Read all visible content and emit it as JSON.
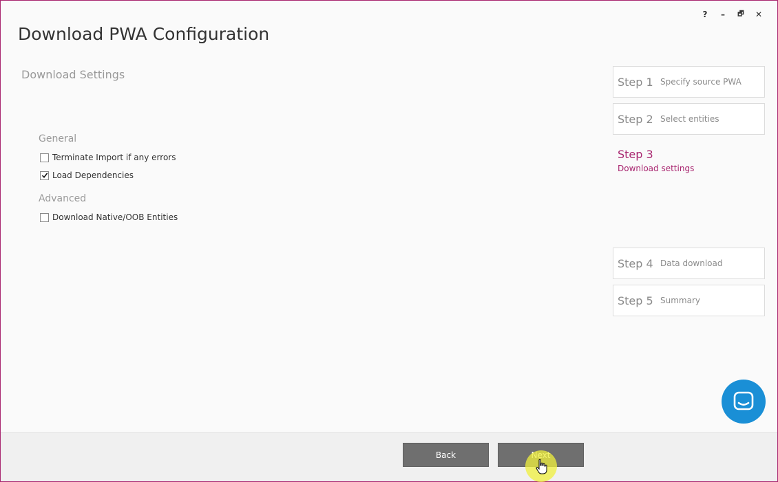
{
  "window": {
    "title": "Download PWA Configuration",
    "controls": {
      "help": "?",
      "minimize": "–",
      "restore": "🗗",
      "close": "✕"
    }
  },
  "section": {
    "title": "Download Settings"
  },
  "general": {
    "label": "General",
    "options": [
      {
        "label": "Terminate Import if any errors",
        "checked": false
      },
      {
        "label": "Load Dependencies",
        "checked": true
      }
    ]
  },
  "advanced": {
    "label": "Advanced",
    "options": [
      {
        "label": "Download Native/OOB Entities",
        "checked": false
      }
    ]
  },
  "steps": [
    {
      "num": "Step 1",
      "desc": "Specify source PWA"
    },
    {
      "num": "Step 2",
      "desc": "Select entities"
    },
    {
      "num": "Step 3",
      "desc": "Download settings",
      "active": true
    },
    {
      "num": "Step 4",
      "desc": "Data download"
    },
    {
      "num": "Step 5",
      "desc": "Summary"
    }
  ],
  "footer": {
    "back_label": "Back",
    "next_label": "Next"
  },
  "colors": {
    "accent": "#a8256f",
    "chat": "#1a8fd6",
    "button": "#6f6f6f"
  },
  "icons": {
    "chat": "chat-bubble-icon",
    "check": "checkmark-icon"
  }
}
